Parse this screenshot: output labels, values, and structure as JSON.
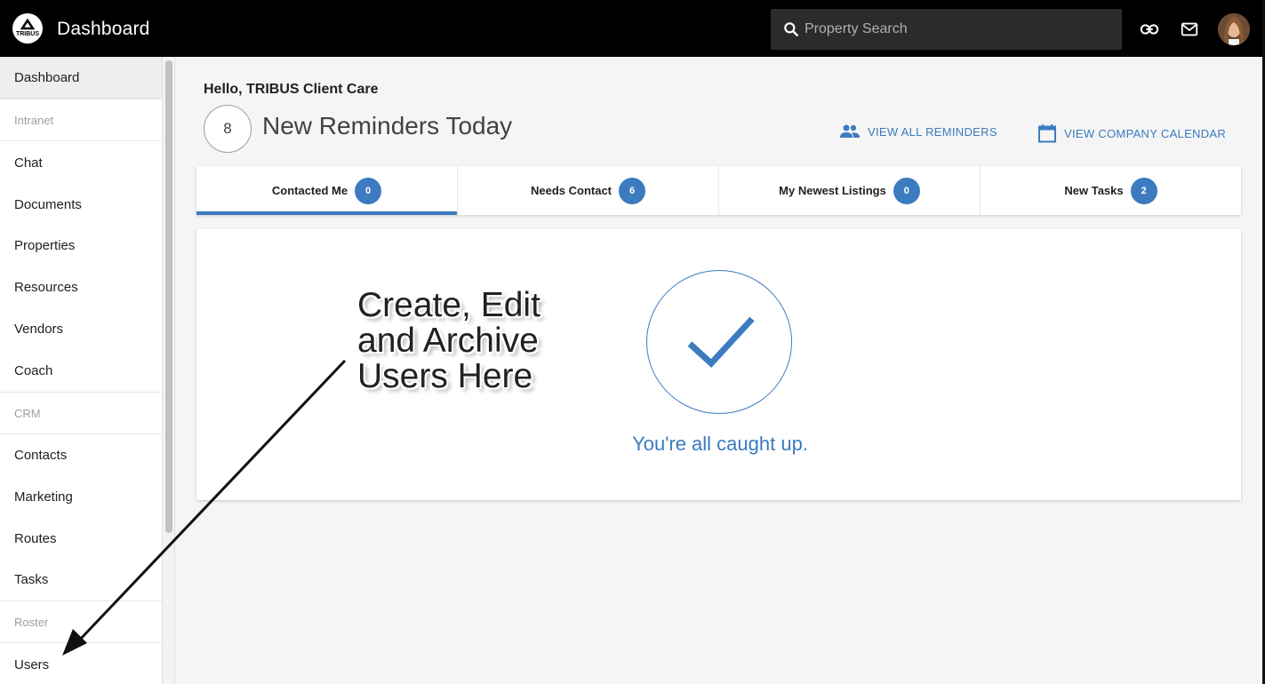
{
  "topbar": {
    "logo_text": "TRIBUS",
    "title": "Dashboard",
    "search_placeholder": "Property Search"
  },
  "sidebar": {
    "items": [
      {
        "label": "Dashboard"
      },
      {
        "label": "Intranet"
      },
      {
        "label": "Chat"
      },
      {
        "label": "Documents"
      },
      {
        "label": "Properties"
      },
      {
        "label": "Resources"
      },
      {
        "label": "Vendors"
      },
      {
        "label": "Coach"
      },
      {
        "label": "CRM"
      },
      {
        "label": "Contacts"
      },
      {
        "label": "Marketing"
      },
      {
        "label": "Routes"
      },
      {
        "label": "Tasks"
      },
      {
        "label": "Roster"
      },
      {
        "label": "Users"
      }
    ]
  },
  "main": {
    "greeting": "Hello, TRIBUS Client Care",
    "reminder_count": "8",
    "reminder_title": "New Reminders Today",
    "view_all_reminders": "VIEW ALL REMINDERS",
    "view_company_calendar": "VIEW COMPANY CALENDAR",
    "tabs": [
      {
        "label": "Contacted Me",
        "count": "0"
      },
      {
        "label": "Needs Contact",
        "count": "6"
      },
      {
        "label": "My Newest Listings",
        "count": "0"
      },
      {
        "label": "New Tasks",
        "count": "2"
      }
    ],
    "empty_message": "You're all caught up."
  },
  "annotation": {
    "lines": [
      "Create, Edit",
      "and Archive",
      "Users Here"
    ]
  },
  "colors": {
    "accent": "#3d7bc0",
    "topbar": "#000000"
  }
}
